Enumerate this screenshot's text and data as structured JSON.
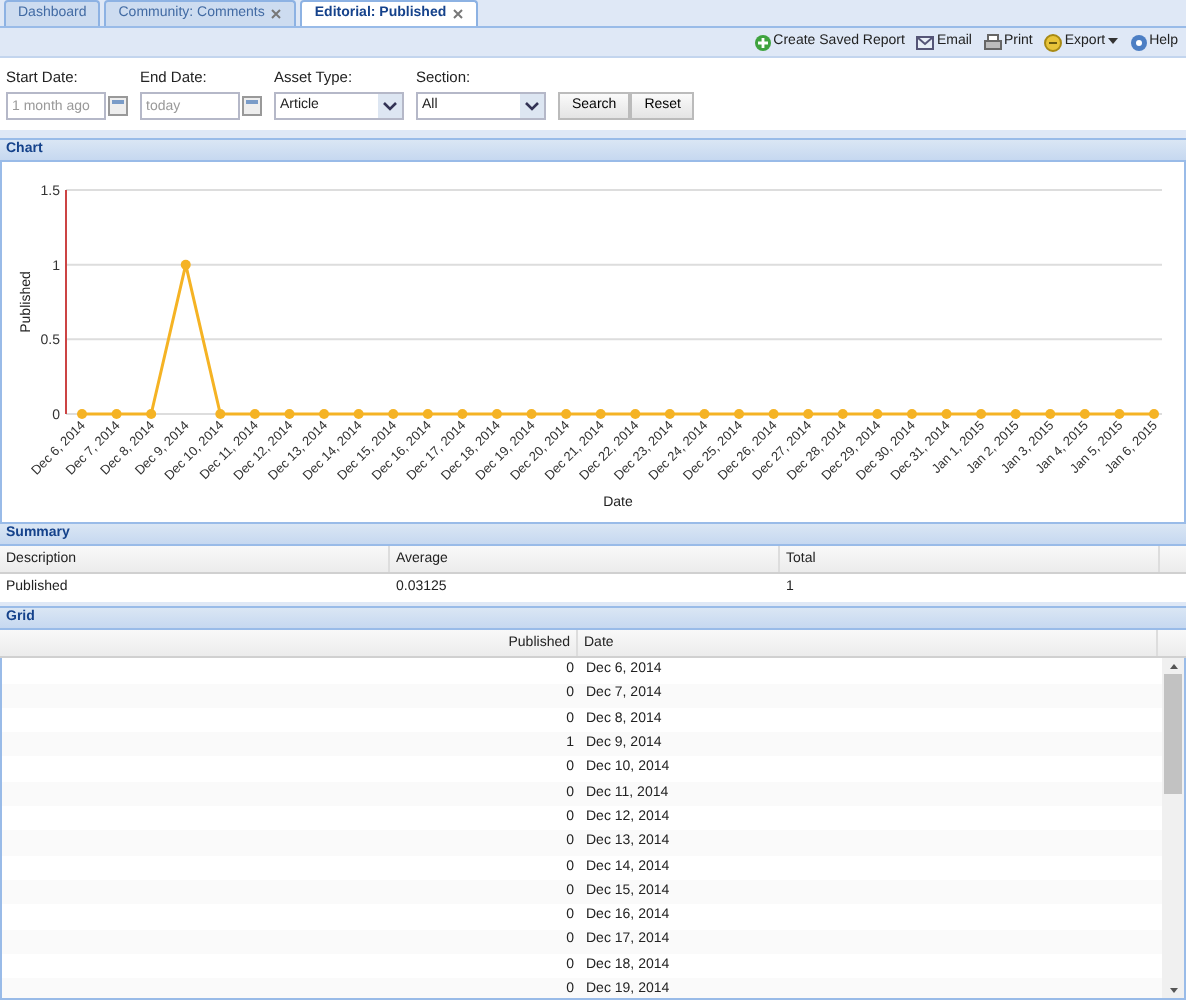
{
  "tabs": [
    {
      "label": "Dashboard",
      "closable": false,
      "selected": false
    },
    {
      "label": "Community: Comments",
      "closable": true,
      "selected": false
    },
    {
      "label": "Editorial: Published",
      "closable": true,
      "selected": true
    }
  ],
  "toolbar": [
    {
      "label": "Create Saved Report",
      "kind": "add",
      "has_menu": false
    },
    {
      "label": "Email",
      "kind": "email",
      "has_menu": false
    },
    {
      "label": "Print",
      "kind": "print",
      "has_menu": false
    },
    {
      "label": "Export",
      "kind": "export",
      "has_menu": true
    },
    {
      "label": "Help",
      "kind": "help",
      "has_menu": false
    }
  ],
  "filters": [
    {
      "label": "Start Date:",
      "kind": "date",
      "placeholder": "1 month ago"
    },
    {
      "label": "End Date:",
      "kind": "date",
      "placeholder": "today"
    },
    {
      "label": "Asset Type:",
      "kind": "select",
      "value": "Article"
    },
    {
      "label": "Section:",
      "kind": "select",
      "value": "All"
    }
  ],
  "buttons": [
    "Search",
    "Reset"
  ],
  "chart": {
    "title": "Chart",
    "chart_data": {
      "type": "line",
      "xlabel": "Date",
      "ylabel": "Published",
      "categories": [
        "Dec 6, 2014",
        "Dec 7, 2014",
        "Dec 8, 2014",
        "Dec 9, 2014",
        "Dec 10, 2014",
        "Dec 11, 2014",
        "Dec 12, 2014",
        "Dec 13, 2014",
        "Dec 14, 2014",
        "Dec 15, 2014",
        "Dec 16, 2014",
        "Dec 17, 2014",
        "Dec 18, 2014",
        "Dec 19, 2014",
        "Dec 20, 2014",
        "Dec 21, 2014",
        "Dec 22, 2014",
        "Dec 23, 2014",
        "Dec 24, 2014",
        "Dec 25, 2014",
        "Dec 26, 2014",
        "Dec 27, 2014",
        "Dec 28, 2014",
        "Dec 29, 2014",
        "Dec 30, 2014",
        "Dec 31, 2014",
        "Jan 1, 2015",
        "Jan 2, 2015",
        "Jan 3, 2015",
        "Jan 4, 2015",
        "Jan 5, 2015",
        "Jan 6, 2015"
      ],
      "series": [
        {
          "color": "#f5b324",
          "marker": "circle",
          "values": [
            0,
            0,
            0,
            1,
            0,
            0,
            0,
            0,
            0,
            0,
            0,
            0,
            0,
            0,
            0,
            0,
            0,
            0,
            0,
            0,
            0,
            0,
            0,
            0,
            0,
            0,
            0,
            0,
            0,
            0,
            0,
            0
          ]
        }
      ],
      "ylim": [
        0,
        1.5
      ],
      "yticks": [
        {
          "value": 0,
          "label": "0"
        },
        {
          "value": 0.5,
          "label": "0.5"
        },
        {
          "value": 1,
          "label": "1"
        },
        {
          "value": 1.5,
          "label": "1.5"
        }
      ]
    }
  },
  "summary": {
    "title": "Summary",
    "columns": [
      "Description",
      "Average",
      "Total"
    ],
    "rows": [
      [
        "Published",
        "0.03125",
        "1"
      ]
    ]
  },
  "grid": {
    "title": "Grid",
    "columns": [
      "Published",
      "Date"
    ],
    "rows": [
      [
        "0",
        "Dec 6, 2014"
      ],
      [
        "0",
        "Dec 7, 2014"
      ],
      [
        "0",
        "Dec 8, 2014"
      ],
      [
        "1",
        "Dec 9, 2014"
      ],
      [
        "0",
        "Dec 10, 2014"
      ],
      [
        "0",
        "Dec 11, 2014"
      ],
      [
        "0",
        "Dec 12, 2014"
      ],
      [
        "0",
        "Dec 13, 2014"
      ],
      [
        "0",
        "Dec 14, 2014"
      ],
      [
        "0",
        "Dec 15, 2014"
      ],
      [
        "0",
        "Dec 16, 2014"
      ],
      [
        "0",
        "Dec 17, 2014"
      ],
      [
        "0",
        "Dec 18, 2014"
      ],
      [
        "0",
        "Dec 19, 2014"
      ]
    ]
  }
}
